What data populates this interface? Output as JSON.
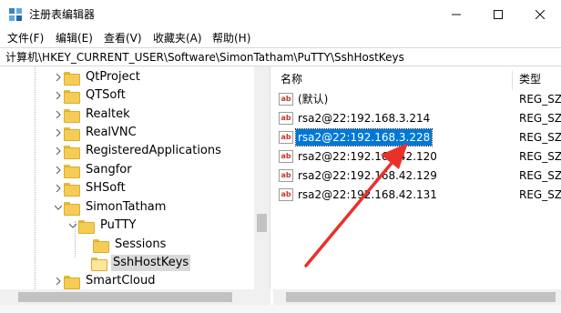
{
  "window": {
    "title": "注册表编辑器",
    "icon": "registry-editor-icon",
    "buttons": {
      "minimize": "minimize-icon",
      "maximize": "maximize-icon",
      "close": "close-icon"
    }
  },
  "menu": [
    "文件(F)",
    "编辑(E)",
    "查看(V)",
    "收藏夹(A)",
    "帮助(H)"
  ],
  "address": "计算机\\HKEY_CURRENT_USER\\Software\\SimonTatham\\PuTTY\\SshHostKeys",
  "tree": [
    {
      "label": "QtProject",
      "depth": 0,
      "expanded": false
    },
    {
      "label": "QTSoft",
      "depth": 0,
      "expanded": false
    },
    {
      "label": "Realtek",
      "depth": 0,
      "expanded": false
    },
    {
      "label": "RealVNC",
      "depth": 0,
      "expanded": false
    },
    {
      "label": "RegisteredApplications",
      "depth": 0,
      "expanded": false
    },
    {
      "label": "Sangfor",
      "depth": 0,
      "expanded": false
    },
    {
      "label": "SHSoft",
      "depth": 0,
      "expanded": false
    },
    {
      "label": "SimonTatham",
      "depth": 0,
      "expanded": true
    },
    {
      "label": "PuTTY",
      "depth": 1,
      "expanded": true
    },
    {
      "label": "Sessions",
      "depth": 2,
      "expanded": false
    },
    {
      "label": "SshHostKeys",
      "depth": 2,
      "expanded": false,
      "selected": true
    },
    {
      "label": "SmartCloud",
      "depth": 0,
      "expanded": false
    }
  ],
  "list": {
    "columns": {
      "name": "名称",
      "type": "类型"
    },
    "rows": [
      {
        "name": "(默认)",
        "type": "REG_SZ"
      },
      {
        "name": "rsa2@22:192.168.3.214",
        "type": "REG_SZ"
      },
      {
        "name": "rsa2@22:192.168.3.228",
        "type": "REG_SZ",
        "selected": true
      },
      {
        "name": "rsa2@22:192.168.42.120",
        "type": "REG_SZ"
      },
      {
        "name": "rsa2@22:192.168.42.129",
        "type": "REG_SZ"
      },
      {
        "name": "rsa2@22:192.168.42.131",
        "type": "REG_SZ"
      }
    ],
    "value_icon": "string-value-icon",
    "value_icon_glyph": "ab"
  },
  "annotation": {
    "color": "#e8312a",
    "shape": "arrow"
  }
}
